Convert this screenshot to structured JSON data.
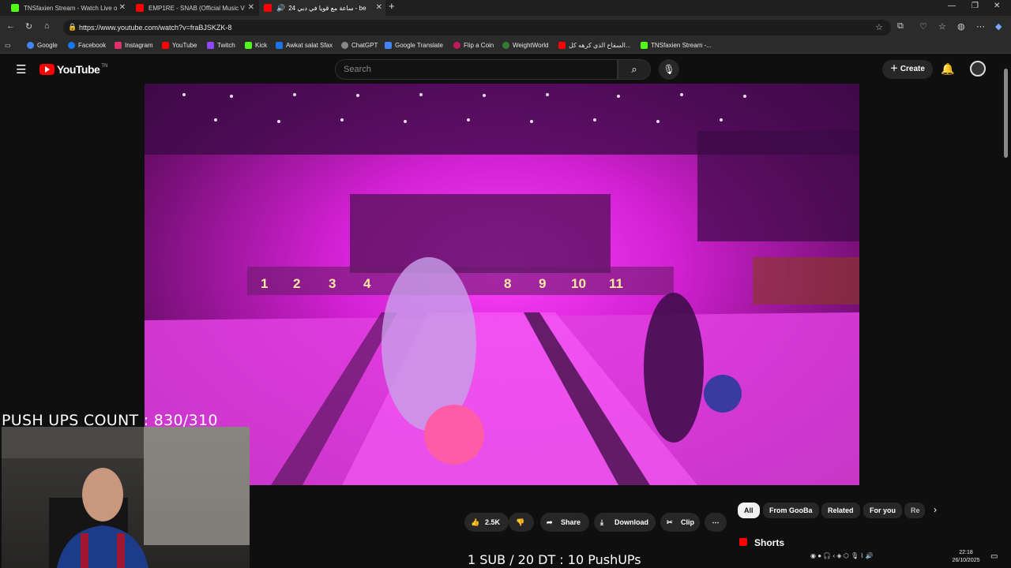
{
  "browser": {
    "tabs": [
      {
        "label": "TNSfaxien Stream - Watch Live o",
        "active": false,
        "favicon": "kick-icon",
        "color": "#53fc18"
      },
      {
        "label": "EMP1RE - SNAB (Official Music V",
        "active": false,
        "favicon": "youtube-icon",
        "color": "#ff0000"
      },
      {
        "label": "24 ساعة مع قويا في دبي - be",
        "active": true,
        "favicon": "youtube-icon",
        "color": "#ff0000"
      }
    ],
    "url": "https://www.youtube.com/watch?v=fraBJSKZK-8",
    "bookmarks": [
      {
        "label": "Google",
        "color": "#4285f4"
      },
      {
        "label": "Facebook",
        "color": "#1877f2"
      },
      {
        "label": "Instagram",
        "color": "#e1306c"
      },
      {
        "label": "YouTube",
        "color": "#ff0000"
      },
      {
        "label": "Twitch",
        "color": "#9146ff"
      },
      {
        "label": "Kick",
        "color": "#53fc18"
      },
      {
        "label": "Awkat salat Sfax",
        "color": "#1a73e8"
      },
      {
        "label": "ChatGPT",
        "color": "#888888"
      },
      {
        "label": "Google Translate",
        "color": "#4285f4"
      },
      {
        "label": "Flip a Coin",
        "color": "#c2185b"
      },
      {
        "label": "WeightWorld",
        "color": "#2e7d32"
      },
      {
        "label": "السفاح الذي كرهه كل...",
        "color": "#ff0000"
      },
      {
        "label": "TNSfaxien Stream -...",
        "color": "#53fc18"
      }
    ]
  },
  "youtube": {
    "logo_text": "YouTube",
    "country": "TN",
    "search_placeholder": "Search",
    "create_label": "Create",
    "video_lane_numbers": [
      "1",
      "2",
      "3",
      "4",
      "8",
      "9",
      "10",
      "11"
    ],
    "actions": {
      "likes": "2.5K",
      "share": "Share",
      "download": "Download",
      "clip": "Clip"
    },
    "chips": [
      "All",
      "From GooBa",
      "Related",
      "For you",
      "Re"
    ],
    "shorts_label": "Shorts"
  },
  "overlay": {
    "pushups": "PUSH UPS COUNT : 830/310",
    "subs": "1 SUB / 20 DT : 10 PushUPs"
  },
  "taskbar": {
    "time": "22:18",
    "date": "26/10/2025"
  }
}
